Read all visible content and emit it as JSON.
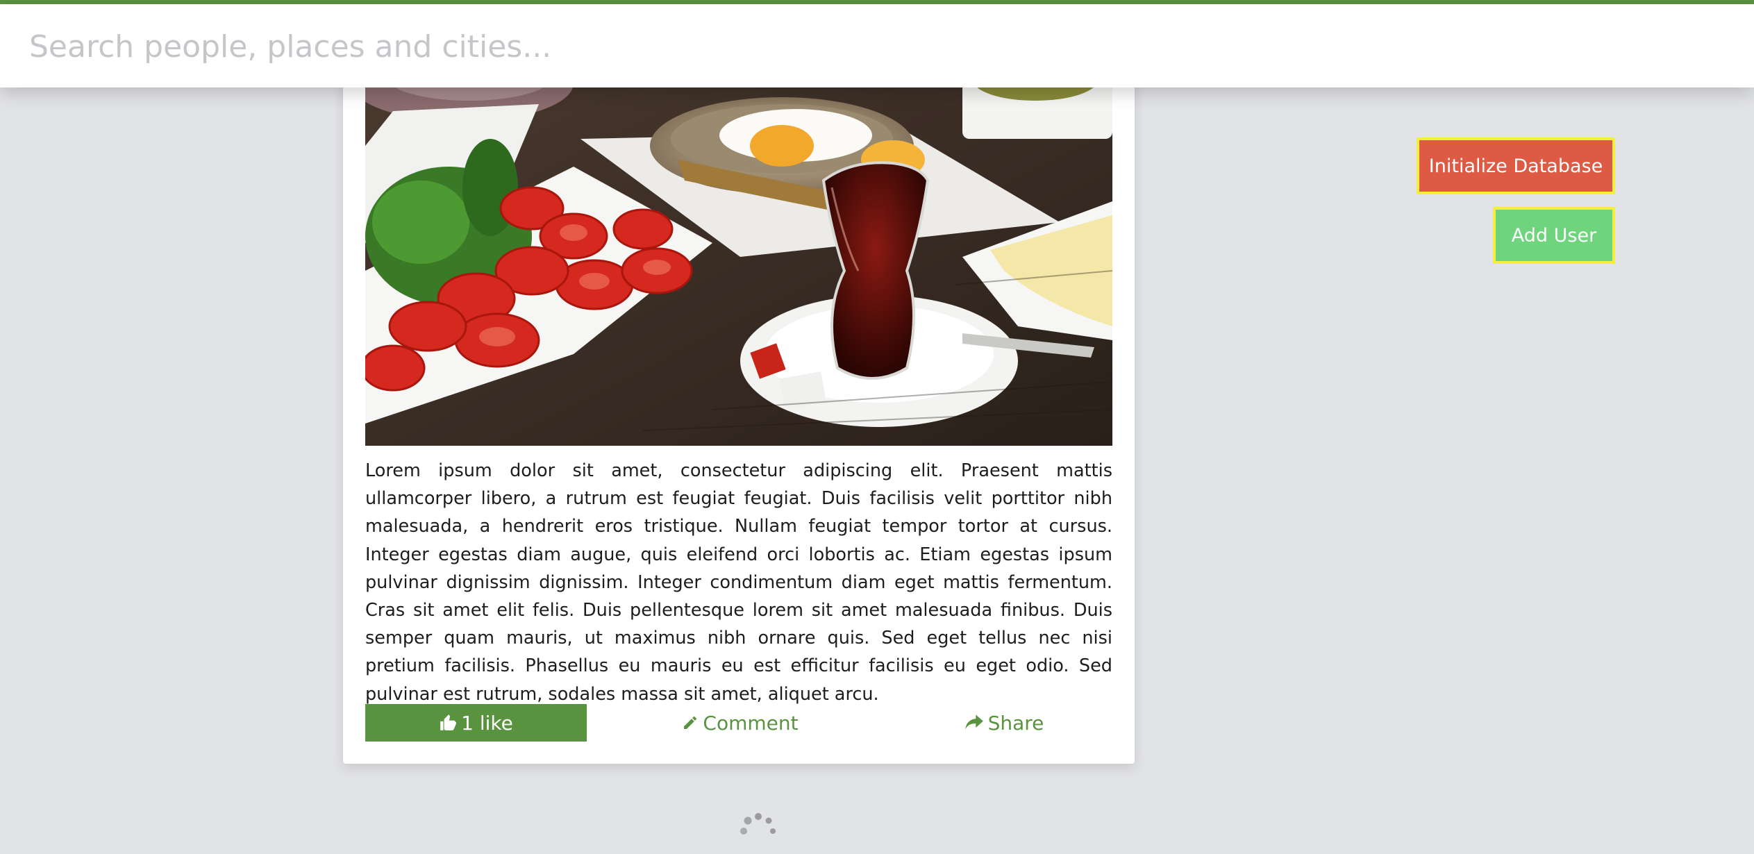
{
  "search": {
    "placeholder": "Search people, places and cities..."
  },
  "post": {
    "body": "Lorem ipsum dolor sit amet, consectetur adipiscing elit. Praesent mattis ullamcorper libero, a rutrum est feugiat feugiat. Duis facilisis velit porttitor nibh malesuada, a hendrerit eros tristique. Nullam feugiat tempor tortor at cursus. Integer egestas diam augue, quis eleifend orci lobortis ac. Etiam egestas ipsum pulvinar dignissim dignissim. Integer condimentum diam eget mattis fermentum. Cras sit amet elit felis. Duis pellentesque lorem sit amet malesuada finibus. Duis semper quam mauris, ut maximus nibh ornare quis. Sed eget tellus nec nisi pretium facilisis. Phasellus eu mauris eu est efficitur facilisis eu eget odio. Sed pulvinar est rutrum, sodales massa sit amet, aliquet arcu.",
    "actions": {
      "like_label": "1 like",
      "comment_label": "Comment",
      "share_label": "Share"
    }
  },
  "admin": {
    "init_db_label": "Initialize Database",
    "add_user_label": "Add User"
  },
  "icons": {
    "like": "thumbs-up-icon",
    "comment": "pencil-icon",
    "share": "share-icon"
  },
  "colors": {
    "accent": "#5a9340",
    "danger": "#dd5a44",
    "success": "#6fd47e",
    "highlight_border": "#f2ef3f",
    "background": "#e2e3e6"
  }
}
